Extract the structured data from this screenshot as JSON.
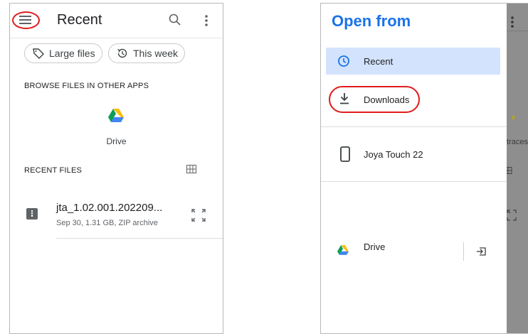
{
  "left": {
    "header_title": "Recent",
    "chips": [
      {
        "label": "Large files",
        "icon": "tag-icon"
      },
      {
        "label": "This week",
        "icon": "history-icon"
      }
    ],
    "browse_heading": "BROWSE FILES IN OTHER APPS",
    "apps": [
      {
        "label": "Drive",
        "icon": "drive-icon"
      }
    ],
    "recent_heading": "RECENT FILES",
    "files": [
      {
        "name": "jta_1.02.001.202209...",
        "meta": "Sep 30, 1.31 GB, ZIP archive",
        "icon": "zip-icon"
      }
    ]
  },
  "right": {
    "drawer_title": "Open from",
    "roots": [
      {
        "label": "Recent",
        "icon": "clock-icon",
        "selected": true
      },
      {
        "label": "Downloads",
        "icon": "download-icon",
        "selected": false
      },
      {
        "label": "Joya Touch 22",
        "icon": "phone-icon",
        "selected": false
      },
      {
        "label": "Drive",
        "icon": "drive-icon",
        "selected": false
      }
    ],
    "background_text": "traces"
  },
  "colors": {
    "accent": "#1a73e8",
    "selected_bg": "#d3e3fd",
    "highlight_ring": "#e01b1b",
    "drive_green": "#0f9d58",
    "drive_yellow": "#fbbc04",
    "drive_blue": "#4285f4"
  }
}
